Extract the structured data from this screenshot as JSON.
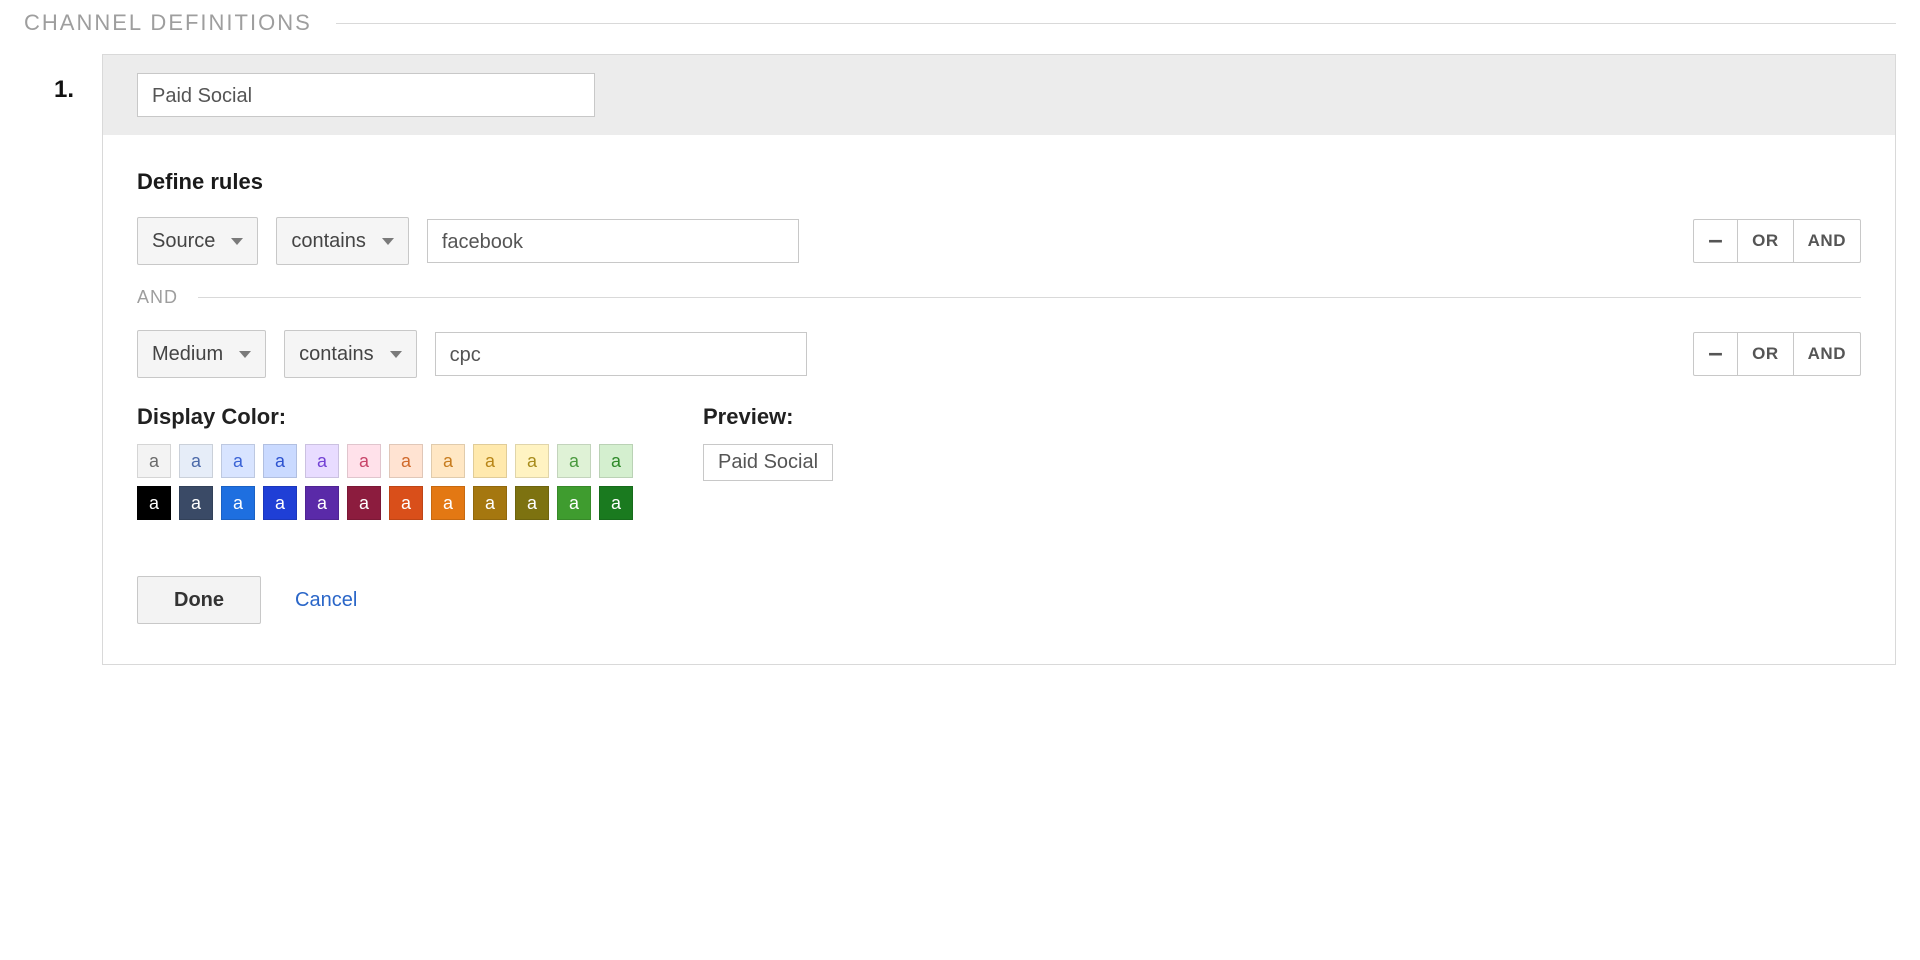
{
  "section_title": "CHANNEL DEFINITIONS",
  "row_number": "1.",
  "channel_name": "Paid Social",
  "define_rules_heading": "Define rules",
  "rules": [
    {
      "dimension": "Source",
      "operator": "contains",
      "value": "facebook"
    },
    {
      "dimension": "Medium",
      "operator": "contains",
      "value": "cpc"
    }
  ],
  "joiner_label": "AND",
  "rule_buttons": {
    "remove": "–",
    "or": "OR",
    "and": "AND"
  },
  "display_color": {
    "title": "Display Color:",
    "glyph": "a",
    "light_row": [
      {
        "bg": "#f3f3f3",
        "fg": "#6a6a6a"
      },
      {
        "bg": "#e6edf8",
        "fg": "#4c6aa9"
      },
      {
        "bg": "#d8e4ff",
        "fg": "#3a63d6"
      },
      {
        "bg": "#cadaff",
        "fg": "#2d53d0"
      },
      {
        "bg": "#e8dcff",
        "fg": "#7342d4"
      },
      {
        "bg": "#ffe1ea",
        "fg": "#c8456a"
      },
      {
        "bg": "#ffe3d2",
        "fg": "#d06a2c"
      },
      {
        "bg": "#ffe7c4",
        "fg": "#c77c1e"
      },
      {
        "bg": "#ffe9ad",
        "fg": "#b88618"
      },
      {
        "bg": "#fff3c2",
        "fg": "#a88c1c"
      },
      {
        "bg": "#dff2d6",
        "fg": "#4b9a3f"
      },
      {
        "bg": "#d4efcf",
        "fg": "#2f8a2a"
      }
    ],
    "dark_row": [
      {
        "bg": "#000000",
        "fg": "#ffffff"
      },
      {
        "bg": "#3a4a66",
        "fg": "#ffffff"
      },
      {
        "bg": "#1e6fe0",
        "fg": "#ffffff"
      },
      {
        "bg": "#1f3fd6",
        "fg": "#ffffff"
      },
      {
        "bg": "#5a2aa8",
        "fg": "#ffffff"
      },
      {
        "bg": "#8c1c3e",
        "fg": "#ffffff"
      },
      {
        "bg": "#d94f1a",
        "fg": "#ffffff"
      },
      {
        "bg": "#e37813",
        "fg": "#ffffff"
      },
      {
        "bg": "#a5770f",
        "fg": "#ffffff"
      },
      {
        "bg": "#7d7210",
        "fg": "#ffffff"
      },
      {
        "bg": "#3f9c2f",
        "fg": "#ffffff"
      },
      {
        "bg": "#1a7a1f",
        "fg": "#ffffff"
      }
    ]
  },
  "preview": {
    "title": "Preview:",
    "value": "Paid Social"
  },
  "footer": {
    "done": "Done",
    "cancel": "Cancel"
  }
}
